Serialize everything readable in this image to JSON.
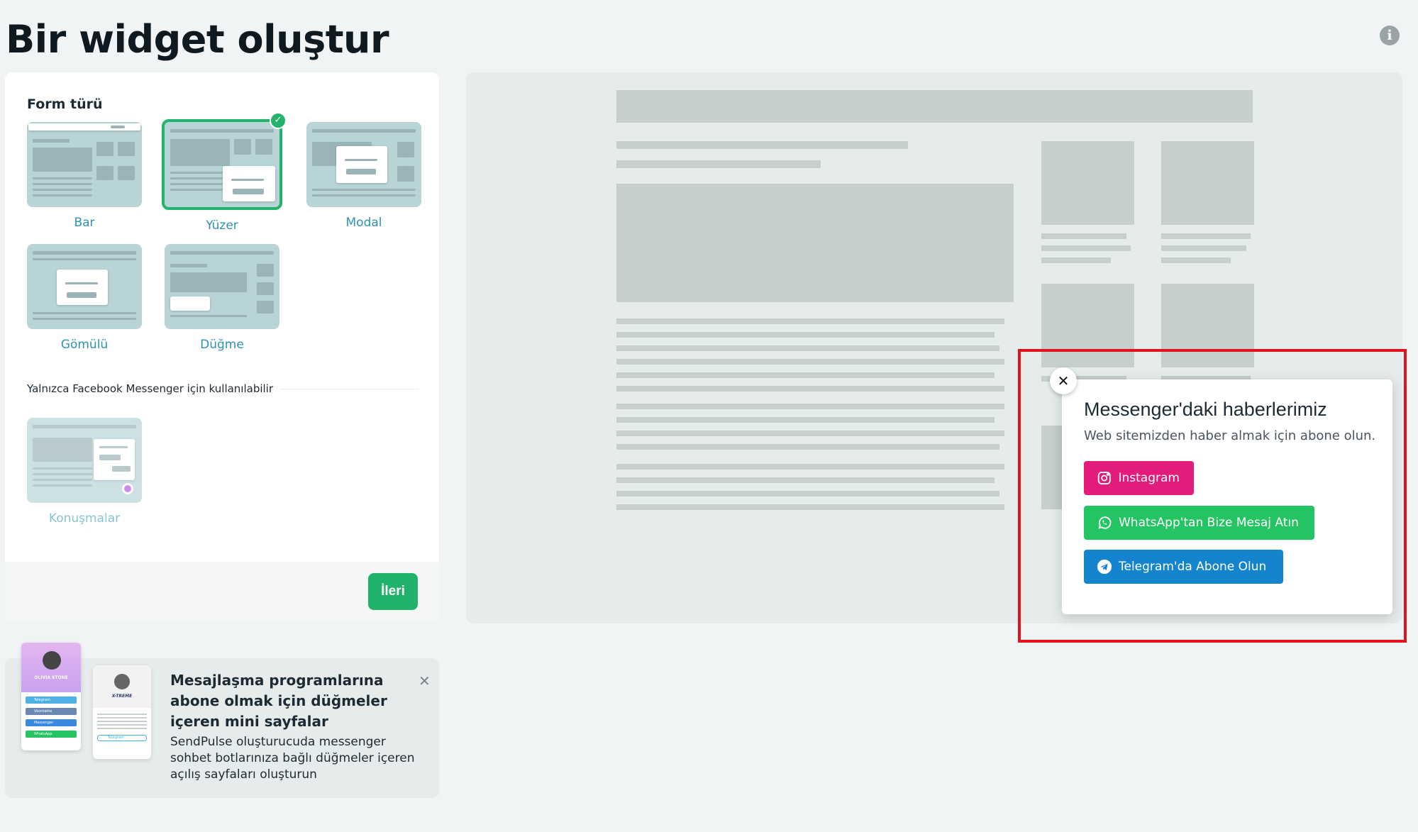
{
  "page": {
    "title": "Bir widget oluştur"
  },
  "form_panel": {
    "label": "Form türü",
    "options": [
      {
        "label": "Bar",
        "selected": false
      },
      {
        "label": "Yüzer",
        "selected": true
      },
      {
        "label": "Modal",
        "selected": false
      },
      {
        "label": "Gömülü",
        "selected": false
      },
      {
        "label": "Düğme",
        "selected": false
      }
    ],
    "messenger_note": "Yalnızca Facebook Messenger için kullanılabilir",
    "messenger_option": {
      "label": "Konuşmalar",
      "enabled": false
    },
    "next_label": "İleri"
  },
  "promo": {
    "title": "Mesajlaşma programlarına abone olmak için düğmeler içeren mini sayfalar",
    "description": "SendPulse oluşturucuda messenger sohbet botlarınıza bağlı düğmeler içeren açılış sayfaları oluşturun"
  },
  "widget": {
    "title": "Messenger'daki haberlerimiz",
    "subtitle": "Web sitemizden haber almak için abone olun.",
    "buttons": {
      "instagram": "Instagram",
      "whatsapp": "WhatsApp'tan Bize Mesaj Atın",
      "telegram": "Telegram'da Abone Olun"
    }
  },
  "colors": {
    "accent_green": "#20b26b",
    "link_blue": "#2c93b4",
    "instagram": "#e31b7a",
    "whatsapp": "#25c462",
    "telegram": "#1584cf",
    "highlight_red": "#e0151c"
  }
}
